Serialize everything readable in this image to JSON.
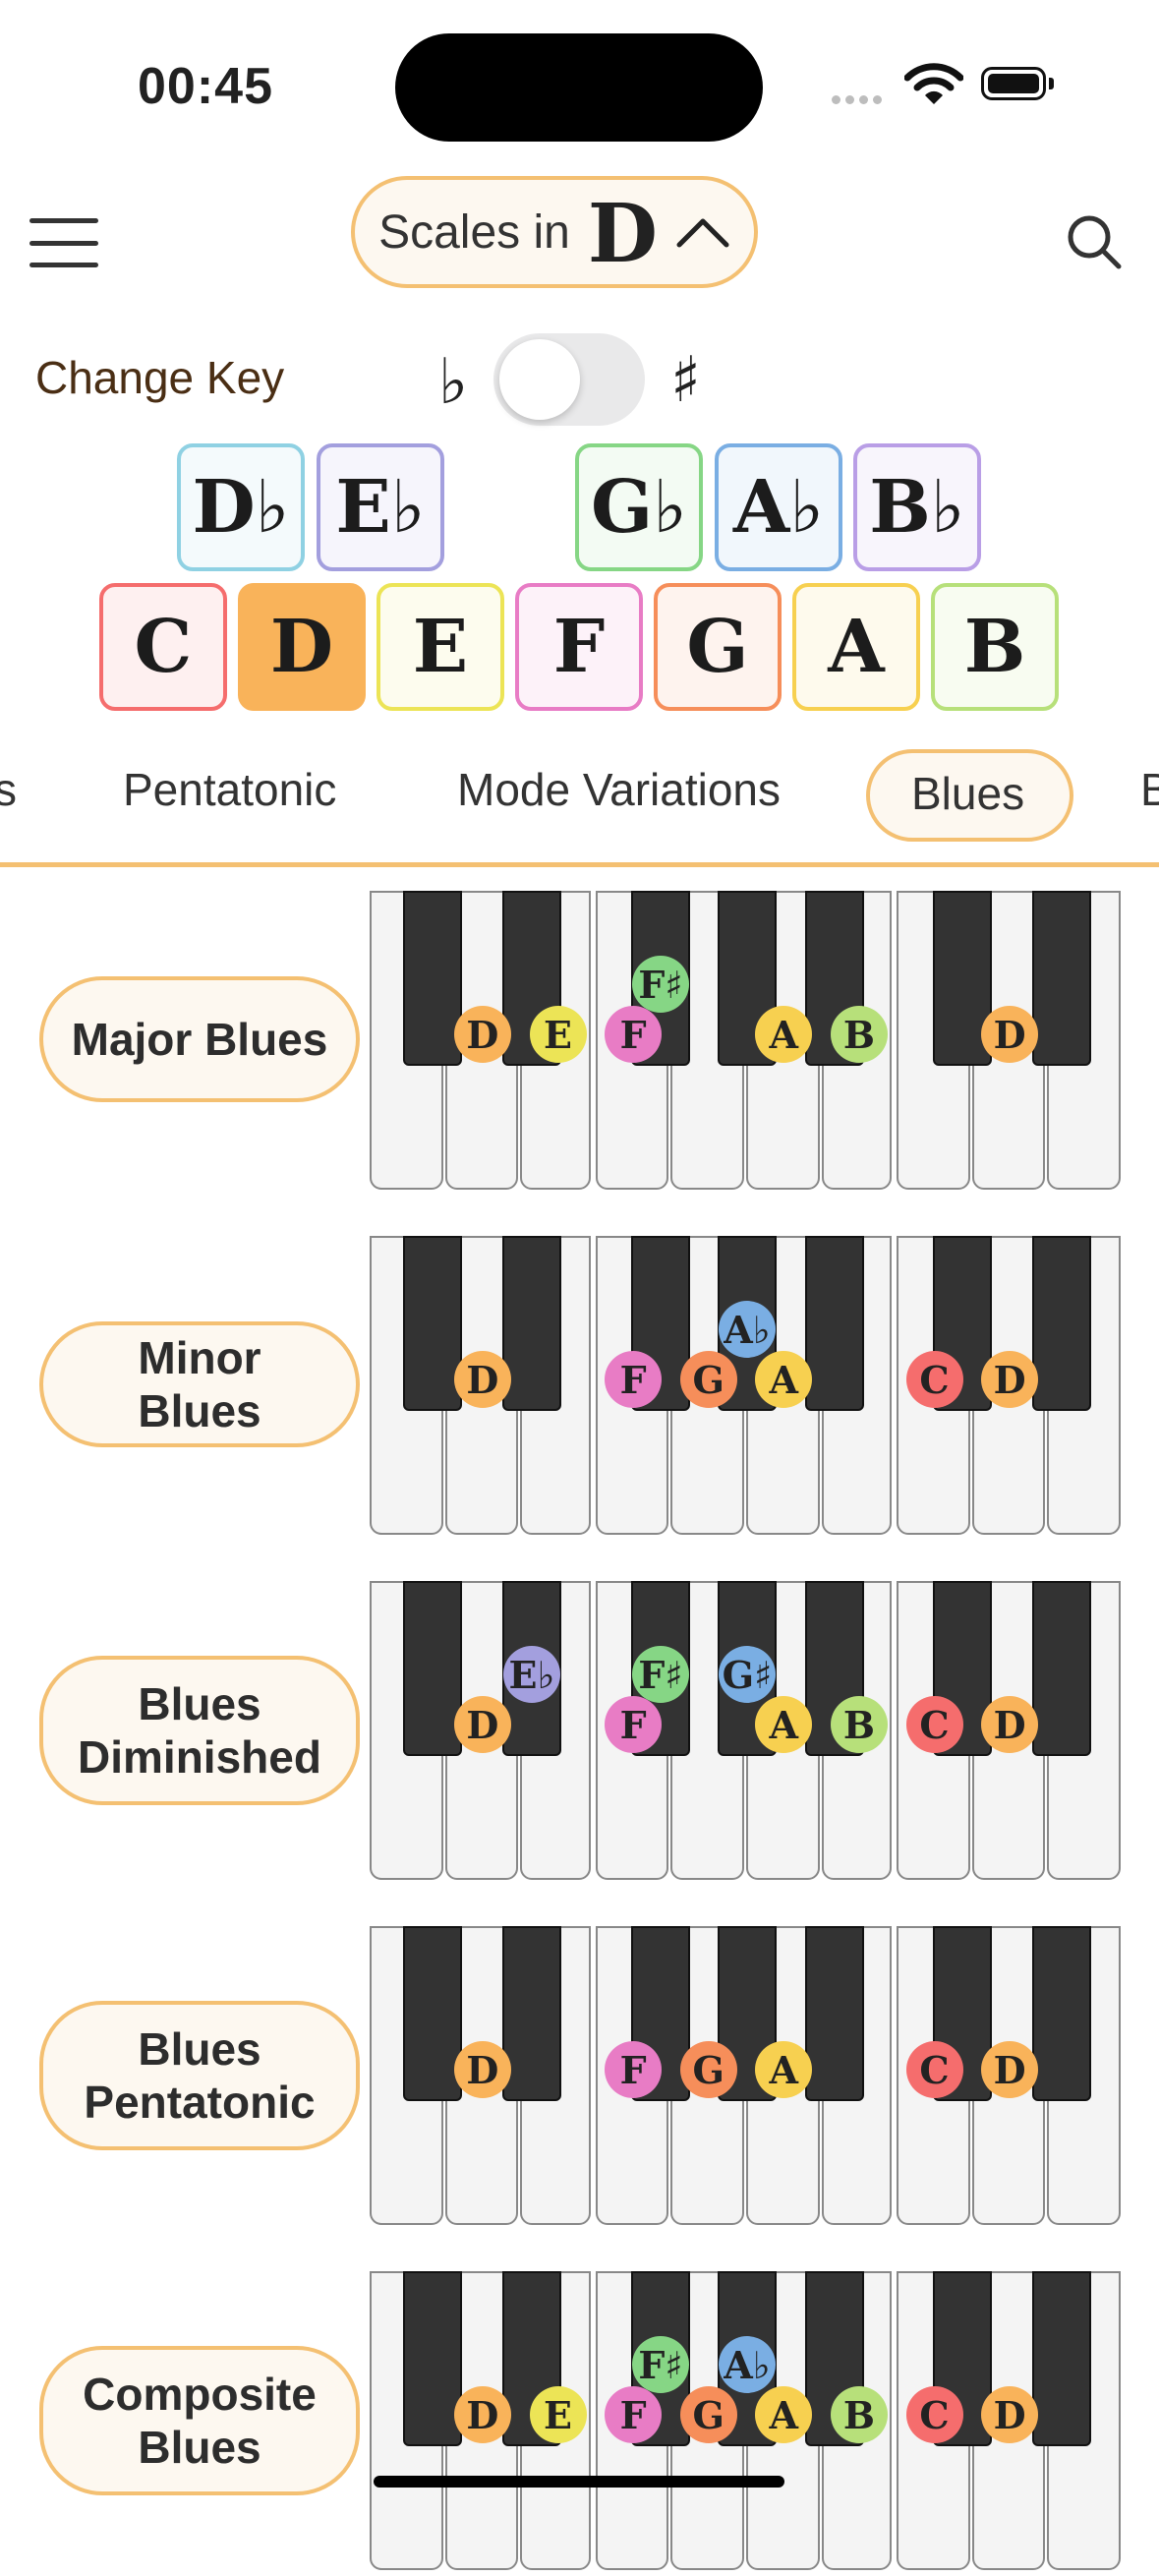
{
  "status": {
    "time": "00:45"
  },
  "header": {
    "title": "Scales in",
    "key": "D"
  },
  "change_key": {
    "label": "Change Key",
    "flat": "♭",
    "sharp": "♯"
  },
  "keys": {
    "accidentals": [
      "D♭",
      "E♭",
      "G♭",
      "A♭",
      "B♭"
    ],
    "naturals": [
      "C",
      "D",
      "E",
      "F",
      "G",
      "A",
      "B"
    ],
    "selected": "D"
  },
  "tabs": {
    "partial_left": "s",
    "pentatonic": "Pentatonic",
    "mode_variations": "Mode Variations",
    "blues": "Blues",
    "partial_right": "B"
  },
  "scales": [
    {
      "name": "Major Blues",
      "notes": [
        "D",
        "E",
        "F",
        "F♯",
        "A",
        "B",
        "D"
      ]
    },
    {
      "name": "Minor Blues",
      "notes": [
        "D",
        "F",
        "G",
        "A♭",
        "A",
        "C",
        "D"
      ]
    },
    {
      "name": "Blues Diminished",
      "notes": [
        "D",
        "E♭",
        "F",
        "F♯",
        "G♯",
        "A",
        "B",
        "C",
        "D"
      ]
    },
    {
      "name": "Blues Pentatonic",
      "notes": [
        "D",
        "F",
        "G",
        "A",
        "C",
        "D"
      ]
    },
    {
      "name": "Composite Blues",
      "notes": [
        "D",
        "E",
        "F",
        "F♯",
        "G",
        "A♭",
        "A",
        "B",
        "C",
        "D"
      ]
    }
  ],
  "colors": {
    "accent": "#f4c072",
    "C": "#f56d6d",
    "D": "#f9b35a",
    "E": "#ece456",
    "F": "#e87cc5",
    "G": "#f68e5a",
    "A": "#f7d050",
    "B": "#b7e07a",
    "Db": "#8fd1e3",
    "Eb": "#a39fde",
    "Gb": "#86d685",
    "Ab": "#7aaee3",
    "Bb": "#b99ee6"
  }
}
